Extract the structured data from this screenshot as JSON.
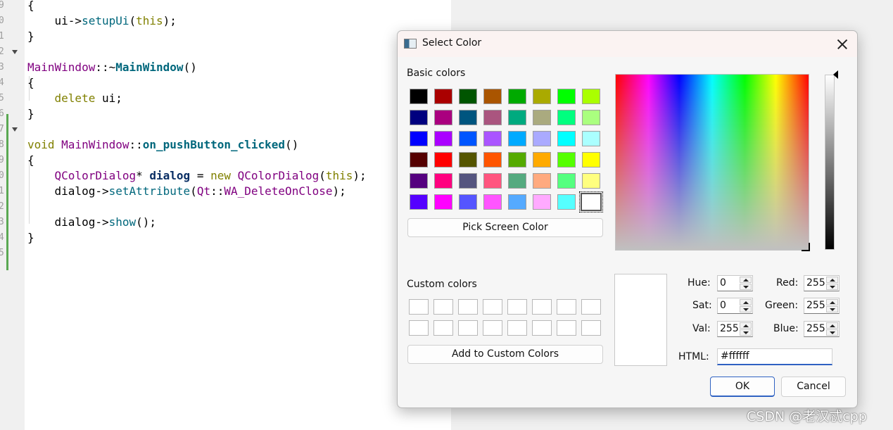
{
  "editor": {
    "line_numbers": [
      "9",
      "0",
      "1",
      "2",
      "3",
      "4",
      "5",
      "6",
      "7",
      "8",
      "9",
      "0",
      "1",
      "2",
      "3",
      "4",
      "5"
    ],
    "lines": [
      [
        {
          "t": "{",
          "c": "plain"
        }
      ],
      [
        {
          "t": "    ui->",
          "c": "plain"
        },
        {
          "t": "setupUi",
          "c": "func"
        },
        {
          "t": "(",
          "c": "plain"
        },
        {
          "t": "this",
          "c": "kw"
        },
        {
          "t": ");",
          "c": "plain"
        }
      ],
      [
        {
          "t": "}",
          "c": "plain"
        }
      ],
      [],
      [
        {
          "t": "MainWindow",
          "c": "type"
        },
        {
          "t": "::~",
          "c": "plain"
        },
        {
          "t": "MainWindow",
          "c": "bold"
        },
        {
          "t": "()",
          "c": "plain"
        }
      ],
      [
        {
          "t": "{",
          "c": "plain"
        }
      ],
      [
        {
          "t": "    ",
          "c": "plain"
        },
        {
          "t": "delete",
          "c": "kw"
        },
        {
          "t": " ui;",
          "c": "plain"
        }
      ],
      [
        {
          "t": "}",
          "c": "plain"
        }
      ],
      [],
      [
        {
          "t": "void",
          "c": "kw"
        },
        {
          "t": " ",
          "c": "plain"
        },
        {
          "t": "MainWindow",
          "c": "type"
        },
        {
          "t": "::",
          "c": "plain"
        },
        {
          "t": "on_pushButton_clicked",
          "c": "bold"
        },
        {
          "t": "()",
          "c": "plain"
        }
      ],
      [
        {
          "t": "{",
          "c": "plain"
        }
      ],
      [
        {
          "t": "    ",
          "c": "plain"
        },
        {
          "t": "QColorDialog",
          "c": "type"
        },
        {
          "t": "* ",
          "c": "plain"
        },
        {
          "t": "dialog",
          "c": "var"
        },
        {
          "t": " = ",
          "c": "plain"
        },
        {
          "t": "new",
          "c": "kw"
        },
        {
          "t": " ",
          "c": "plain"
        },
        {
          "t": "QColorDialog",
          "c": "type"
        },
        {
          "t": "(",
          "c": "plain"
        },
        {
          "t": "this",
          "c": "kw"
        },
        {
          "t": ");",
          "c": "plain"
        }
      ],
      [
        {
          "t": "    dialog->",
          "c": "plain"
        },
        {
          "t": "setAttribute",
          "c": "func"
        },
        {
          "t": "(",
          "c": "plain"
        },
        {
          "t": "Qt",
          "c": "type"
        },
        {
          "t": "::",
          "c": "plain"
        },
        {
          "t": "WA_DeleteOnClose",
          "c": "enum"
        },
        {
          "t": ");",
          "c": "plain"
        }
      ],
      [],
      [
        {
          "t": "    dialog->",
          "c": "plain"
        },
        {
          "t": "show",
          "c": "func"
        },
        {
          "t": "();",
          "c": "plain"
        }
      ],
      [
        {
          "t": "}",
          "c": "plain"
        }
      ]
    ]
  },
  "dialog": {
    "title": "Select Color",
    "basic_colors_label": "Basic colors",
    "custom_colors_label": "Custom colors",
    "pick_screen_button": "Pick Screen Color",
    "add_custom_button": "Add to Custom Colors",
    "basic_colors": [
      [
        "#000000",
        "#aa0000",
        "#005500",
        "#aa5500",
        "#00aa00",
        "#aaaa00",
        "#00ff00",
        "#aaff00"
      ],
      [
        "#00007f",
        "#aa007f",
        "#00557f",
        "#aa557f",
        "#00aa7f",
        "#aaaa7f",
        "#00ff7f",
        "#aaff7f"
      ],
      [
        "#0000ff",
        "#aa00ff",
        "#0055ff",
        "#aa55ff",
        "#00aaff",
        "#aaaaff",
        "#00ffff",
        "#aaffff"
      ],
      [
        "#550000",
        "#ff0000",
        "#555500",
        "#ff5500",
        "#55aa00",
        "#ffaa00",
        "#55ff00",
        "#ffff00"
      ],
      [
        "#55007f",
        "#ff007f",
        "#55557f",
        "#ff557f",
        "#55aa7f",
        "#ffaa7f",
        "#55ff7f",
        "#ffff7f"
      ],
      [
        "#5500ff",
        "#ff00ff",
        "#5555ff",
        "#ff55ff",
        "#55aaff",
        "#ffaaff",
        "#55ffff",
        "#ffffff"
      ]
    ],
    "custom_colors": [
      [
        "#ffffff",
        "#ffffff",
        "#ffffff",
        "#ffffff",
        "#ffffff",
        "#ffffff",
        "#ffffff",
        "#ffffff"
      ],
      [
        "#ffffff",
        "#ffffff",
        "#ffffff",
        "#ffffff",
        "#ffffff",
        "#ffffff",
        "#ffffff",
        "#ffffff"
      ]
    ],
    "fields": {
      "hue": {
        "label": "Hue:",
        "value": "0"
      },
      "sat": {
        "label": "Sat:",
        "value": "0"
      },
      "val": {
        "label": "Val:",
        "value": "255"
      },
      "red": {
        "label": "Red:",
        "value": "255"
      },
      "green": {
        "label": "Green:",
        "value": "255"
      },
      "blue": {
        "label": "Blue:",
        "value": "255"
      }
    },
    "html_label": "HTML:",
    "html_value": "#ffffff",
    "ok_button": "OK",
    "cancel_button": "Cancel",
    "selected_color": "#ffffff"
  },
  "watermark": "CSDN @老汉忒cpp"
}
